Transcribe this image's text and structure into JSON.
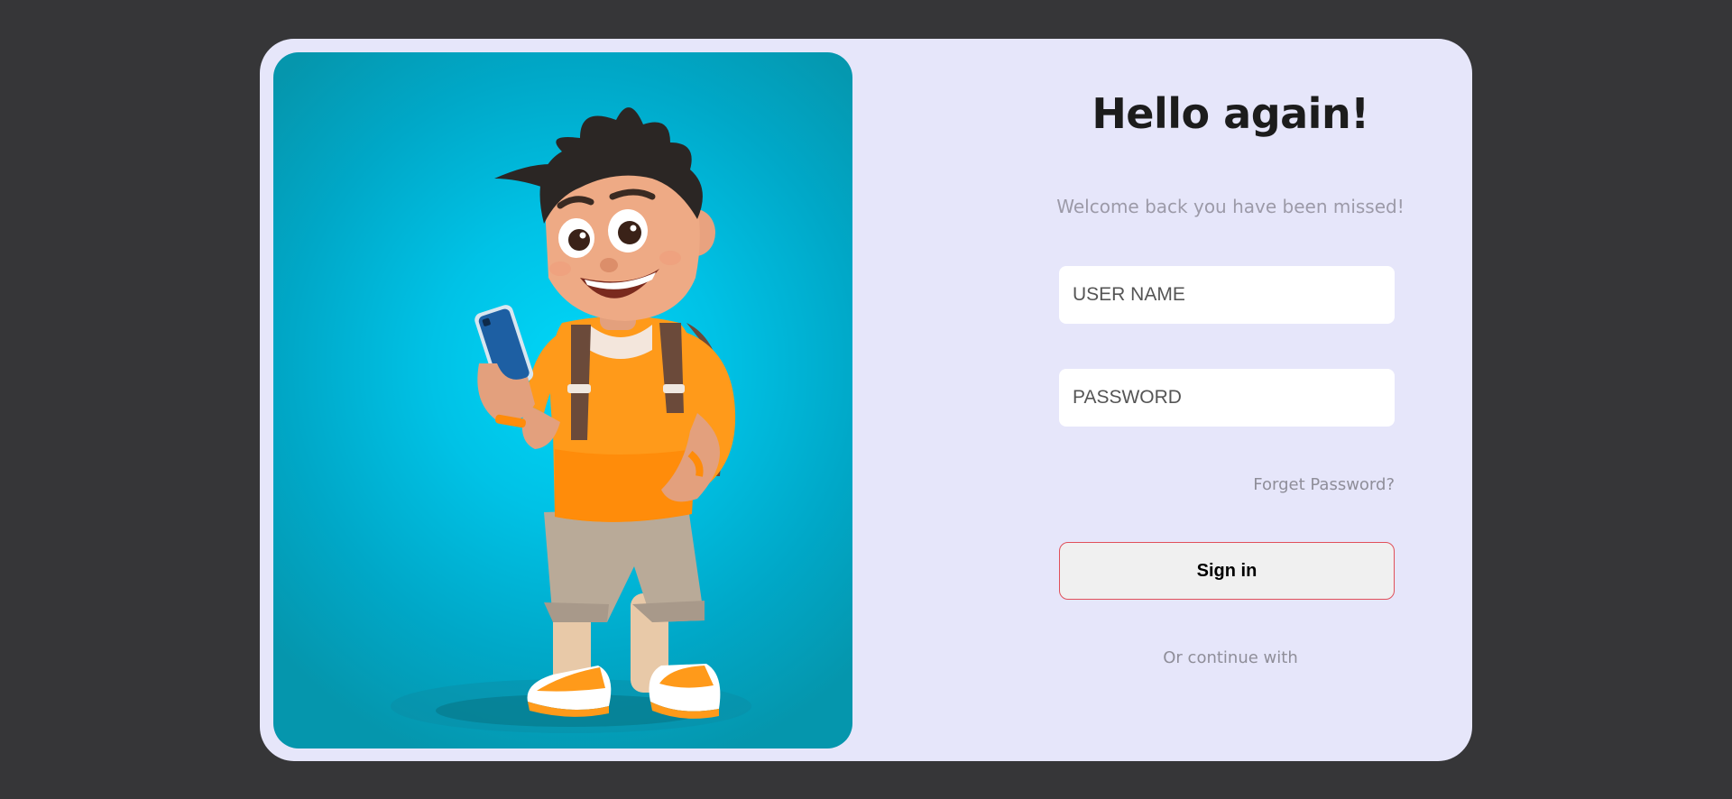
{
  "login": {
    "title": "Hello again!",
    "subtitle": "Welcome back you have been missed!",
    "username_placeholder": "USER NAME",
    "password_placeholder": "PASSWORD",
    "forgot_password": "Forget Password?",
    "signin_label": "Sign in",
    "continue_with": "Or continue with"
  },
  "hero": {
    "illustration": "cartoon-boy-with-phone-and-backpack"
  },
  "colors": {
    "page_background": "#363638",
    "card_background": "#e6e6fa",
    "hero_background": "#00c2e6",
    "signin_border": "#e0505a",
    "shirt": "#ff9a1a"
  }
}
